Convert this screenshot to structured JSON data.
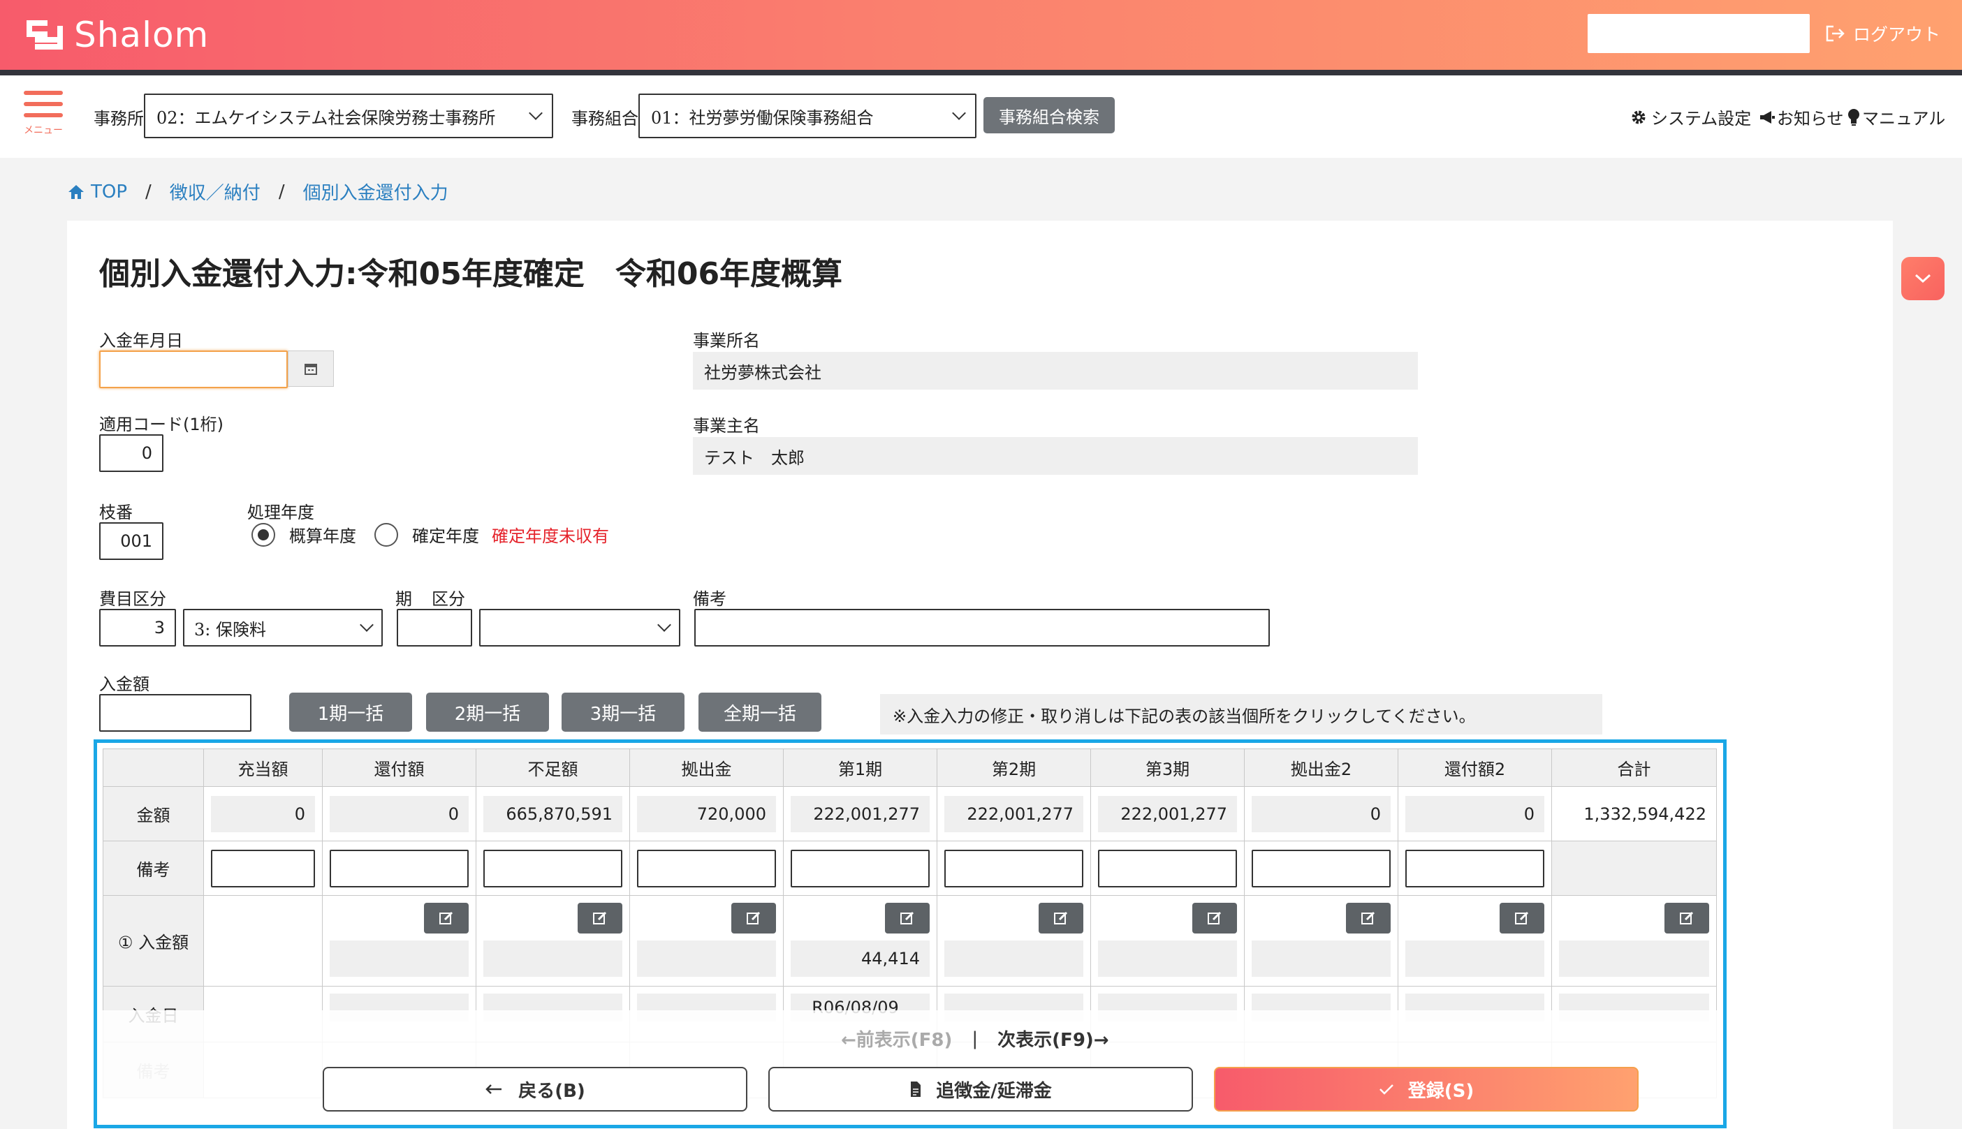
{
  "header": {
    "app_name": "Shalom",
    "logout_label": "ログアウト",
    "search_value": ""
  },
  "toolbar": {
    "menu_label": "メニュー",
    "office_label": "事務所",
    "office_value": "02：エムケイシステム社会保険労務士事務所",
    "union_label": "事務組合",
    "union_value": "01：社労夢労働保険事務組合",
    "union_search_label": "事務組合検索",
    "settings_label": "システム設定",
    "notice_label": "お知らせ",
    "manual_label": "マニュアル"
  },
  "breadcrumb": {
    "top": "TOP",
    "sep": "/",
    "level2": "徴収／納付",
    "level3": "個別入金還付入力"
  },
  "page": {
    "title": "個別入金還付入力:令和05年度確定　令和06年度概算"
  },
  "form": {
    "payment_date_label": "入金年月日",
    "payment_date_value": "",
    "apply_code_label": "適用コード(1桁)",
    "apply_code_value": "0",
    "branch_label": "枝番",
    "branch_value": "001",
    "fiscal_label": "処理年度",
    "fiscal_option1": "概算年度",
    "fiscal_option2": "確定年度",
    "fiscal_warning": "確定年度未収有",
    "business_name_label": "事業所名",
    "business_name_value": "社労夢株式会社",
    "owner_label": "事業主名",
    "owner_value": "テスト　太郎",
    "expense_label": "費目区分",
    "expense_code": "3",
    "expense_select": "3: 保険料",
    "period_label": "期",
    "category_label": "区分",
    "period_value": "",
    "category_value": "",
    "remarks_label": "備考",
    "remarks_value": "",
    "amount_label": "入金額",
    "amount_value": "",
    "bulk1_label": "1期一括",
    "bulk2_label": "2期一括",
    "bulk3_label": "3期一括",
    "bulk_all_label": "全期一括",
    "notice": "※入金入力の修正・取り消しは下記の表の該当個所をクリックしてください。"
  },
  "table": {
    "columns": [
      "充当額",
      "還付額",
      "不足額",
      "拠出金",
      "第1期",
      "第2期",
      "第3期",
      "拠出金2",
      "還付額2",
      "合計"
    ],
    "row_amount_label": "金額",
    "amounts": [
      "0",
      "0",
      "665,870,591",
      "720,000",
      "222,001,277",
      "222,001,277",
      "222,001,277",
      "0",
      "0",
      "1,332,594,422"
    ],
    "row_remarks_label": "備考",
    "row_payment_label": "① 入金額",
    "payment_values": [
      "",
      "",
      "",
      "44,414",
      "",
      "",
      "",
      "",
      ""
    ],
    "row_date_label": "入金日",
    "date_values": [
      "",
      "",
      "",
      "R06/08/09",
      "",
      "",
      "",
      "",
      ""
    ],
    "row_remarks2_label": "備考"
  },
  "footer": {
    "prev_label": "←前表示(F8)",
    "pager_sep": "|",
    "next_label": "次表示(F9)→",
    "back_label": "戻る(B)",
    "additional_label": "追徴金/延滞金",
    "save_label": "登録(S)"
  },
  "colors": {
    "header_start": "#f75b6b",
    "header_end": "#ffa16f",
    "link": "#2a7fc0",
    "warning": "#e5232b",
    "gray_button": "#6e7378",
    "focus_frame": "#1aa7e6"
  }
}
